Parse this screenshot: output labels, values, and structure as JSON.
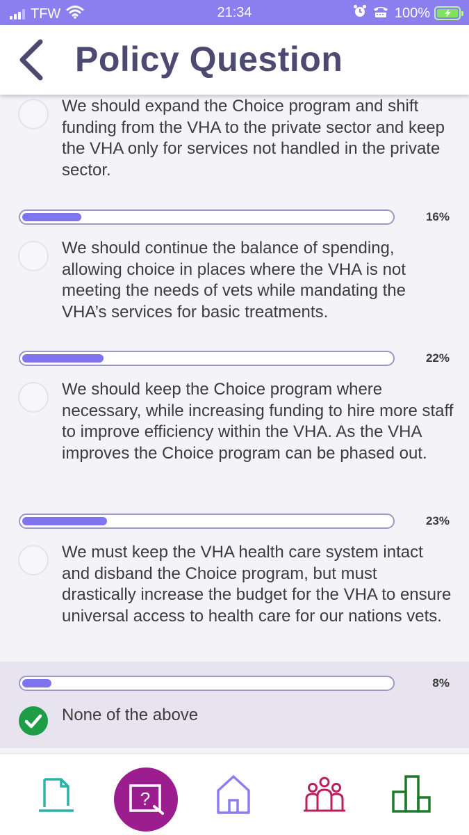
{
  "status_bar": {
    "carrier": "TFW",
    "time": "21:34",
    "battery": "100%",
    "icons": [
      "signal-icon",
      "wifi-icon",
      "alarm-icon",
      "tty-icon",
      "battery-charging-icon"
    ]
  },
  "header": {
    "title": "Policy Question",
    "back_icon": "chevron-left-icon"
  },
  "options": [
    {
      "text": "We should expand the Choice program and shift funding from the VHA to the private sector and keep the VHA only for services not handled in the private sector.",
      "percent_label": "16%",
      "percent": 16,
      "selected": false
    },
    {
      "text": "We should continue the balance of spending, allowing choice in places where the VHA is not meeting the needs of vets while mandating the VHA’s services for basic treatments.",
      "percent_label": "22%",
      "percent": 22,
      "selected": false
    },
    {
      "text": "We should keep the Choice program where necessary, while increasing funding to hire more staff to improve efficiency within the VHA. As the VHA improves the Choice program can be phased out.",
      "percent_label": "23%",
      "percent": 23,
      "selected": false
    },
    {
      "text": "We must keep the VHA health care system intact and disband the Choice program, but must drastically increase the budget for the VHA to ensure universal access to health care for our nations vets.",
      "percent_label": "8%",
      "percent": 8,
      "selected": false
    },
    {
      "text": "None of the above",
      "selected": true
    }
  ],
  "colors": {
    "status_bar": "#8b7ff0",
    "title": "#4d4a72",
    "bar_fill": "#8074ee",
    "bar_border": "#9c97c4",
    "selected_bg": "#e7e4f0",
    "check": "#1f9c46",
    "nav_active": "#9c1d8e",
    "nav_document": "#2bb3a7",
    "nav_home": "#8b7ff0",
    "nav_people": "#b8215d",
    "nav_stats": "#1c7a2a"
  },
  "bottom_nav": [
    {
      "icon": "document-icon",
      "active": false
    },
    {
      "icon": "question-icon",
      "active": true
    },
    {
      "icon": "home-icon",
      "active": false
    },
    {
      "icon": "people-icon",
      "active": false
    },
    {
      "icon": "bar-chart-icon",
      "active": false
    }
  ]
}
